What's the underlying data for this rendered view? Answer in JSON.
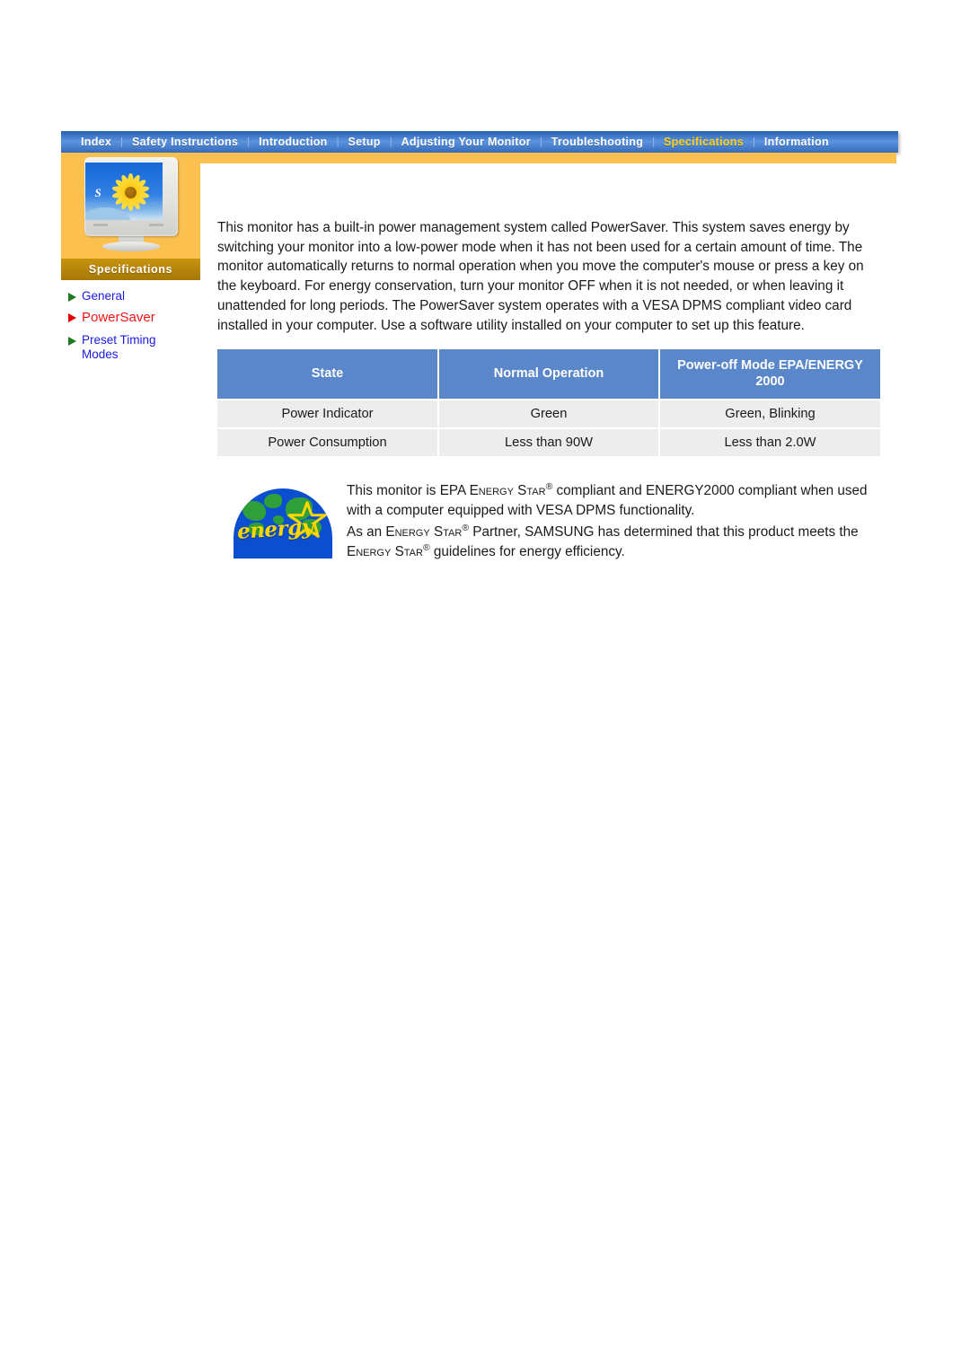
{
  "topnav": {
    "items": [
      {
        "label": "Index",
        "active": false
      },
      {
        "label": "Safety Instructions",
        "active": false
      },
      {
        "label": "Introduction",
        "active": false
      },
      {
        "label": "Setup",
        "active": false
      },
      {
        "label": "Adjusting Your Monitor",
        "active": false
      },
      {
        "label": "Troubleshooting",
        "active": false
      },
      {
        "label": "Specifications",
        "active": true
      },
      {
        "label": "Information",
        "active": false
      }
    ],
    "separator": "|",
    "bar_color": "#3b72c4",
    "active_color": "#ffd21c"
  },
  "sidebar": {
    "band_label": "Specifications",
    "band_color": "#b5840a",
    "frame_color": "#fcc04f",
    "monitor_screen_letter": "S",
    "items": [
      {
        "label": "General",
        "current": false,
        "bullet": "green-triangle-icon"
      },
      {
        "label": "PowerSaver",
        "current": true,
        "bullet": "red-triangle-icon"
      },
      {
        "label": "Preset Timing Modes",
        "current": false,
        "bullet": "green-triangle-icon"
      }
    ]
  },
  "main": {
    "intro_paragraph": "This monitor has a built-in power management system called PowerSaver. This system saves energy by switching your monitor into a low-power mode when it has not been used for a certain amount of time. The monitor automatically returns to normal operation when you move the computer's mouse or press a key on the keyboard. For energy conservation, turn your monitor OFF when it is not needed, or when leaving it unattended for long periods. The PowerSaver system operates with a VESA DPMS compliant video card installed in your computer. Use a software utility installed on your computer to set up this feature.",
    "table": {
      "header_color": "#5a87c9",
      "row_color": "#ededed",
      "columns": [
        "State",
        "Normal Operation",
        "Power-off Mode EPA/ENERGY 2000"
      ],
      "column_lines": [
        [
          "State"
        ],
        [
          "Normal Operation"
        ],
        [
          "Power-off Mode EPA/ENERGY",
          "2000"
        ]
      ],
      "rows": [
        [
          "Power Indicator",
          "Green",
          "Green, Blinking"
        ],
        [
          "Power Consumption",
          "Less than 90W",
          "Less than 2.0W"
        ]
      ]
    },
    "energy_star": {
      "logo_word": "energy",
      "logo_name": "energy-star-logo",
      "line1_a": "This monitor is EPA ",
      "line1_sc": "Energy Star",
      "line1_b": " compliant and ENERGY2000 compliant when used with a computer equipped with VESA DPMS functionality.",
      "line2_a": "As an ",
      "line2_sc": "Energy Star",
      "line2_b": " Partner, SAMSUNG has determined that this product meets the ",
      "line2_sc2": "Energy Star",
      "line2_c": " guidelines for energy efficiency.",
      "registered_symbol": "®"
    }
  }
}
